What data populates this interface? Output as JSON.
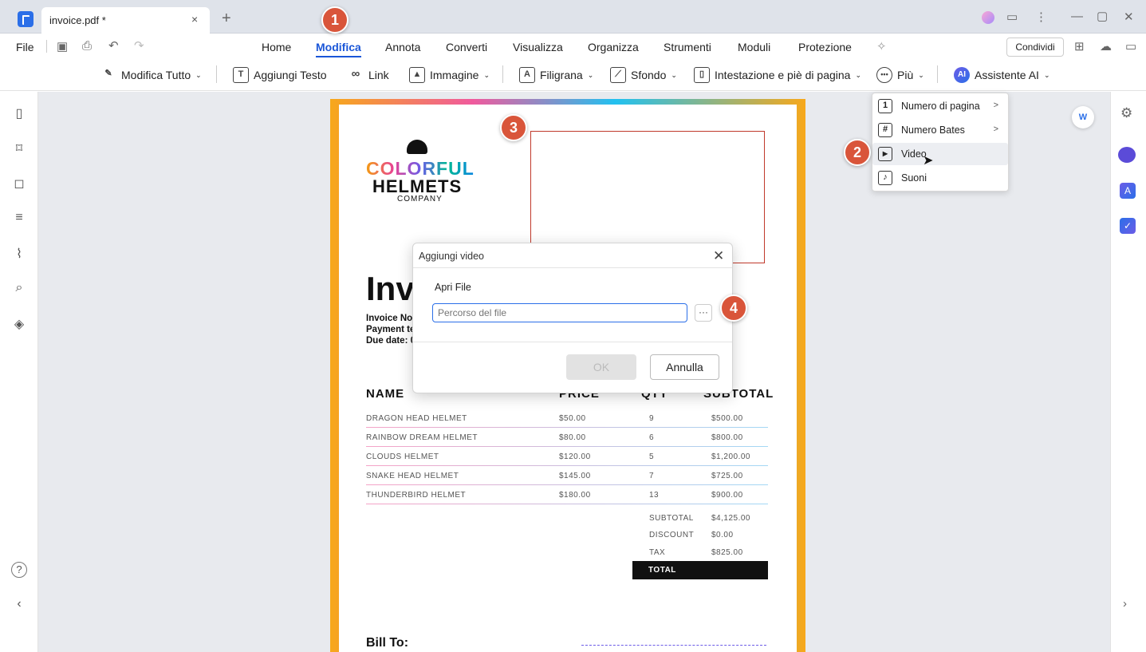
{
  "window": {
    "tab_title": "invoice.pdf *",
    "tab_close": "×",
    "new_tab": "+",
    "controls": {
      "minimize": "—",
      "maximize": "▢",
      "close": "✕"
    }
  },
  "menubar": {
    "file": "File",
    "items": [
      "Home",
      "Modifica",
      "Annota",
      "Converti",
      "Visualizza",
      "Organizza",
      "Strumenti",
      "Moduli",
      "Protezione"
    ],
    "share": "Condividi"
  },
  "toolbar": {
    "edit_all": "Modifica Tutto",
    "add_text": "Aggiungi Testo",
    "link": "Link",
    "image": "Immagine",
    "watermark": "Filigrana",
    "background": "Sfondo",
    "header_footer": "Intestazione e piè di pagina",
    "more": "Più",
    "ai": "Assistente AI",
    "ai_badge": "AI"
  },
  "dropdown": {
    "items": [
      {
        "label": "Numero di pagina",
        "icon": "1",
        "has_submenu": true
      },
      {
        "label": "Numero Bates",
        "icon": "#",
        "has_submenu": true
      },
      {
        "label": "Video",
        "icon": "▶",
        "has_submenu": false
      },
      {
        "label": "Suoni",
        "icon": "♪",
        "has_submenu": false
      }
    ],
    "submenu_arrow": ">"
  },
  "dialog": {
    "title": "Aggiungi video",
    "section_label": "Apri File",
    "path_placeholder": "Percorso del file",
    "browse": "···",
    "ok": "OK",
    "cancel": "Annulla"
  },
  "document": {
    "logo_line1": "COLORFUL",
    "logo_line2": "HELMETS",
    "logo_line3": "COMPANY",
    "title": "Invo",
    "meta": [
      "Invoice No:",
      "Payment te",
      "Due date: 0"
    ],
    "table_headers": [
      "NAME",
      "PRICE",
      "QTY",
      "SUBTOTAL"
    ],
    "rows": [
      [
        "DRAGON HEAD HELMET",
        "$50.00",
        "9",
        "$500.00"
      ],
      [
        "RAINBOW DREAM HELMET",
        "$80.00",
        "6",
        "$800.00"
      ],
      [
        "CLOUDS HELMET",
        "$120.00",
        "5",
        "$1,200.00"
      ],
      [
        "SNAKE HEAD HELMET",
        "$145.00",
        "7",
        "$725.00"
      ],
      [
        "THUNDERBIRD HELMET",
        "$180.00",
        "13",
        "$900.00"
      ]
    ],
    "summary": [
      {
        "label": "SUBTOTAL",
        "value": "$4,125.00"
      },
      {
        "label": "DISCOUNT",
        "value": "$0.00"
      },
      {
        "label": "TAX",
        "value": "$825.00"
      }
    ],
    "total_label": "TOTAL",
    "bill_to": "Bill To:"
  },
  "badges": [
    "1",
    "2",
    "3",
    "4"
  ],
  "colors": {
    "accent": "#1a56d8",
    "badge": "#d9553a"
  }
}
